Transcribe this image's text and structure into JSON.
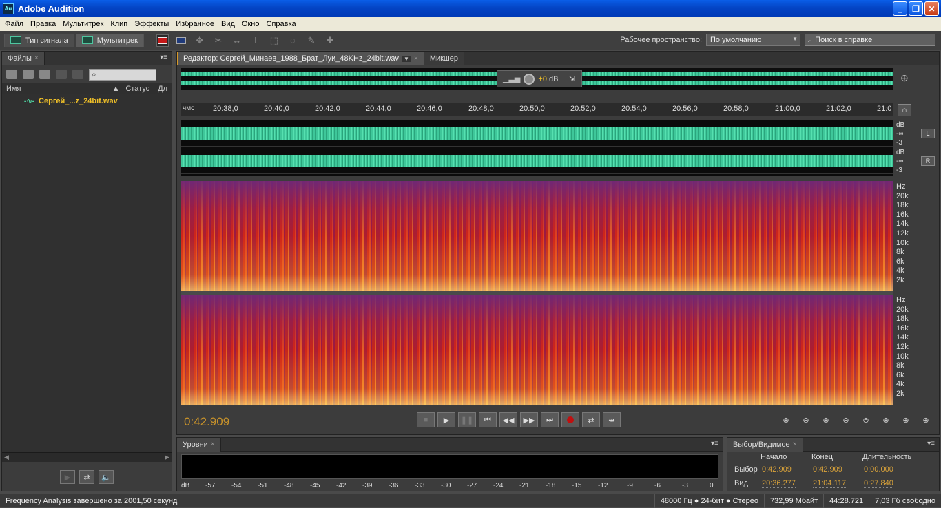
{
  "window": {
    "title": "Adobe Audition",
    "icon": "Au"
  },
  "menu": [
    "Файл",
    "Правка",
    "Мультитрек",
    "Клип",
    "Эффекты",
    "Избранное",
    "Вид",
    "Окно",
    "Справка"
  ],
  "toolbar": {
    "waveform_label": "Тип сигнала",
    "multitrack_label": "Мультитрек",
    "workspace_label": "Рабочее пространство:",
    "workspace_value": "По умолчанию",
    "help_search": "Поиск в справке"
  },
  "files": {
    "tab": "Файлы",
    "columns": [
      "Имя",
      "Статус",
      "Дл"
    ],
    "items": [
      {
        "name": "Сергей_...z_24bit.wav"
      }
    ]
  },
  "editor": {
    "tab_active": "Редактор: Сергей_Минаев_1988_Брат_Луи_48KHz_24bit.wav",
    "tab_mixer": "Микшер",
    "volume": "+0",
    "volume_unit": "dB",
    "ruler_unit": "чмс",
    "ruler_ticks": [
      "20:38,0",
      "20:40,0",
      "20:42,0",
      "20:44,0",
      "20:46,0",
      "20:48,0",
      "20:50,0",
      "20:52,0",
      "20:54,0",
      "20:56,0",
      "20:58,0",
      "21:00,0",
      "21:02,0",
      "21:0"
    ],
    "channel_left": "L",
    "channel_right": "R",
    "db_scale": [
      "dB",
      "-∞",
      "-3"
    ],
    "hz_scale": [
      "Hz",
      "20k",
      "18k",
      "16k",
      "14k",
      "12k",
      "10k",
      "8k",
      "6k",
      "4k",
      "2k"
    ],
    "current_time": "0:42.909"
  },
  "levels": {
    "tab": "Уровни",
    "scale": [
      "dB",
      "-57",
      "-54",
      "-51",
      "-48",
      "-45",
      "-42",
      "-39",
      "-36",
      "-33",
      "-30",
      "-27",
      "-24",
      "-21",
      "-18",
      "-15",
      "-12",
      "-9",
      "-6",
      "-3",
      "0"
    ]
  },
  "selection": {
    "tab": "Выбор/Видимое",
    "headers": [
      "Начало",
      "Конец",
      "Длительность"
    ],
    "rows": [
      {
        "label": "Выбор",
        "start": "0:42.909",
        "end": "0:42.909",
        "duration": "0:00.000"
      },
      {
        "label": "Вид",
        "start": "20:36.277",
        "end": "21:04.117",
        "duration": "0:27.840"
      }
    ]
  },
  "status": {
    "message": "Frequency Analysis завершено за 2001,50 секунд",
    "format": "48000 Гц ● 24-бит ● Стерео",
    "size": "732,99 Мбайт",
    "duration": "44:28.721",
    "free": "7,03 Гб свободно"
  }
}
